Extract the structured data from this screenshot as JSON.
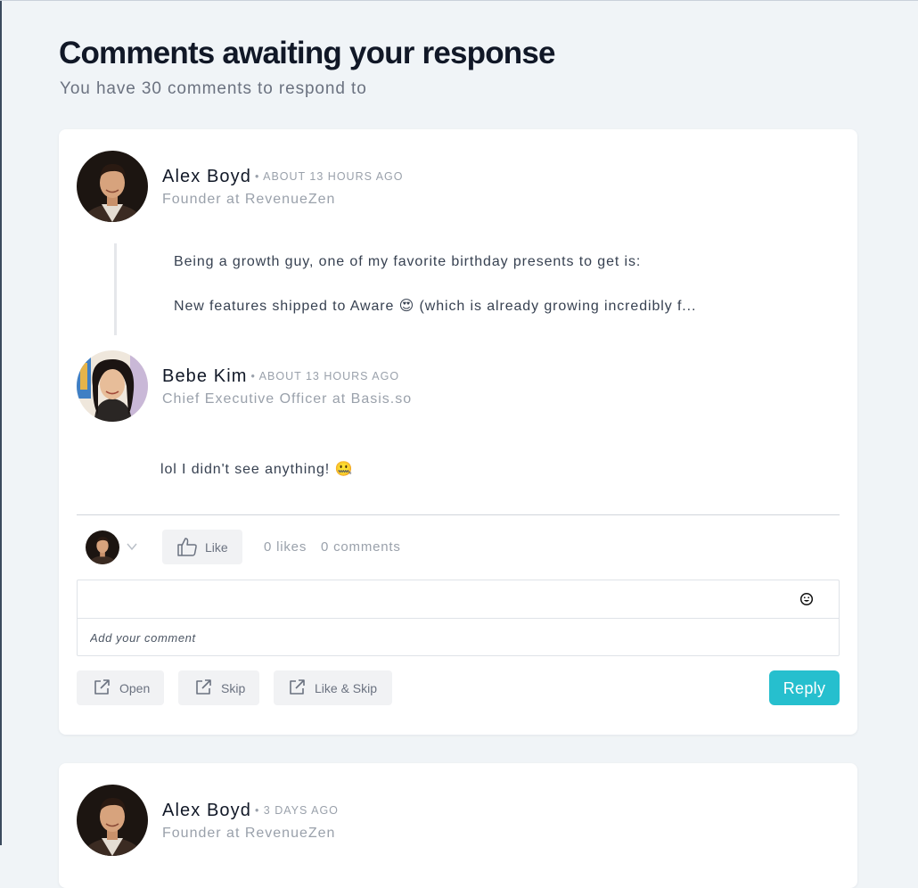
{
  "page": {
    "title": "Comments awaiting your response",
    "subtitle": "You have 30 comments to respond to"
  },
  "cards": [
    {
      "author": {
        "name": "Alex Boyd",
        "time": "• ABOUT 13 HOURS AGO",
        "role": "Founder at RevenueZen"
      },
      "post_lines": [
        "Being a growth guy, one of my favorite birthday presents to get is:",
        "New features shipped to Aware 😍 (which is already growing incredibly f..."
      ],
      "reply": {
        "author": {
          "name": "Bebe Kim",
          "time": "• ABOUT 13 HOURS AGO",
          "role": "Chief Executive Officer at Basis.so"
        },
        "text": "lol I didn't see anything! 🤐"
      },
      "like_button": "Like",
      "likes_count": "0 likes",
      "comments_count": "0 comments",
      "comment_placeholder": "Add your comment",
      "actions": {
        "open": "Open",
        "skip": "Skip",
        "like_skip": "Like & Skip",
        "reply": "Reply"
      }
    },
    {
      "author": {
        "name": "Alex Boyd",
        "time": "• 3 DAYS AGO",
        "role": "Founder at RevenueZen"
      }
    }
  ],
  "colors": {
    "background": "#f0f4f7",
    "card": "#ffffff",
    "reply_button": "#26bfce",
    "muted_text": "#9aa1ab"
  },
  "icons": [
    "thumbs-up-icon",
    "chevron-down-icon",
    "emoji-icon",
    "external-link-icon"
  ]
}
